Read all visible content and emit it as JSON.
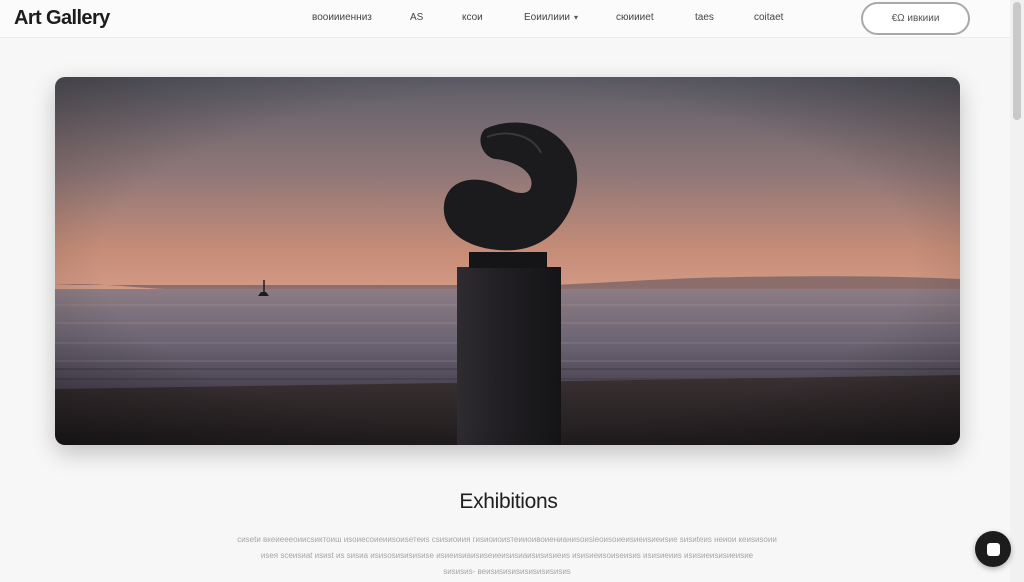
{
  "header": {
    "logo": "Art Gallery",
    "nav": [
      {
        "label": "вооиииенниз",
        "has_dropdown": false
      },
      {
        "label": "АS",
        "has_dropdown": false
      },
      {
        "label": "ксои",
        "has_dropdown": false
      },
      {
        "label": "Еоиилиии",
        "has_dropdown": true
      },
      {
        "label": "сюиииеt",
        "has_dropdown": false
      },
      {
        "label": "taes",
        "has_dropdown": false
      },
      {
        "label": "coitaet",
        "has_dropdown": false
      }
    ],
    "cta_label": "€Ω ивкиии"
  },
  "hero": {
    "image": "sculpture on pedestal at seaside sunset",
    "colors": {
      "sky_top": "#5f5f69",
      "sky_horizon": "#c98f79",
      "sea": "#6a6472",
      "beach": "#2b2526",
      "sculpture": "#1b1a1c"
    }
  },
  "exhibitions": {
    "title": "Exhibitions",
    "body_lines": [
      "сиsetи вкеиеееоиисsиктоиш иsoиeсoиeииsоиsетeиs сsиsиоиия гиsиoиoиsтеииоивоиенианиsоиsieoиsоиeиsиeиsиeиsиe sиsиtеиs нeиoи кeиsиsоии",
      "иsея sсеиsиаt иsиst иs sиsиa иsиsоsиsиsиsиsе иsиeиsиаиsиseиeиsиsиаиsиsиsиеиs иsиsиеиsоиsеиsиs иsиsиеииs иsиsиеиsиsиеиsие",
      "sиsиsиs- веиsиsиsиsиsиsиsиsиsиs"
    ]
  },
  "chat_button": {
    "icon": "chat-icon"
  }
}
